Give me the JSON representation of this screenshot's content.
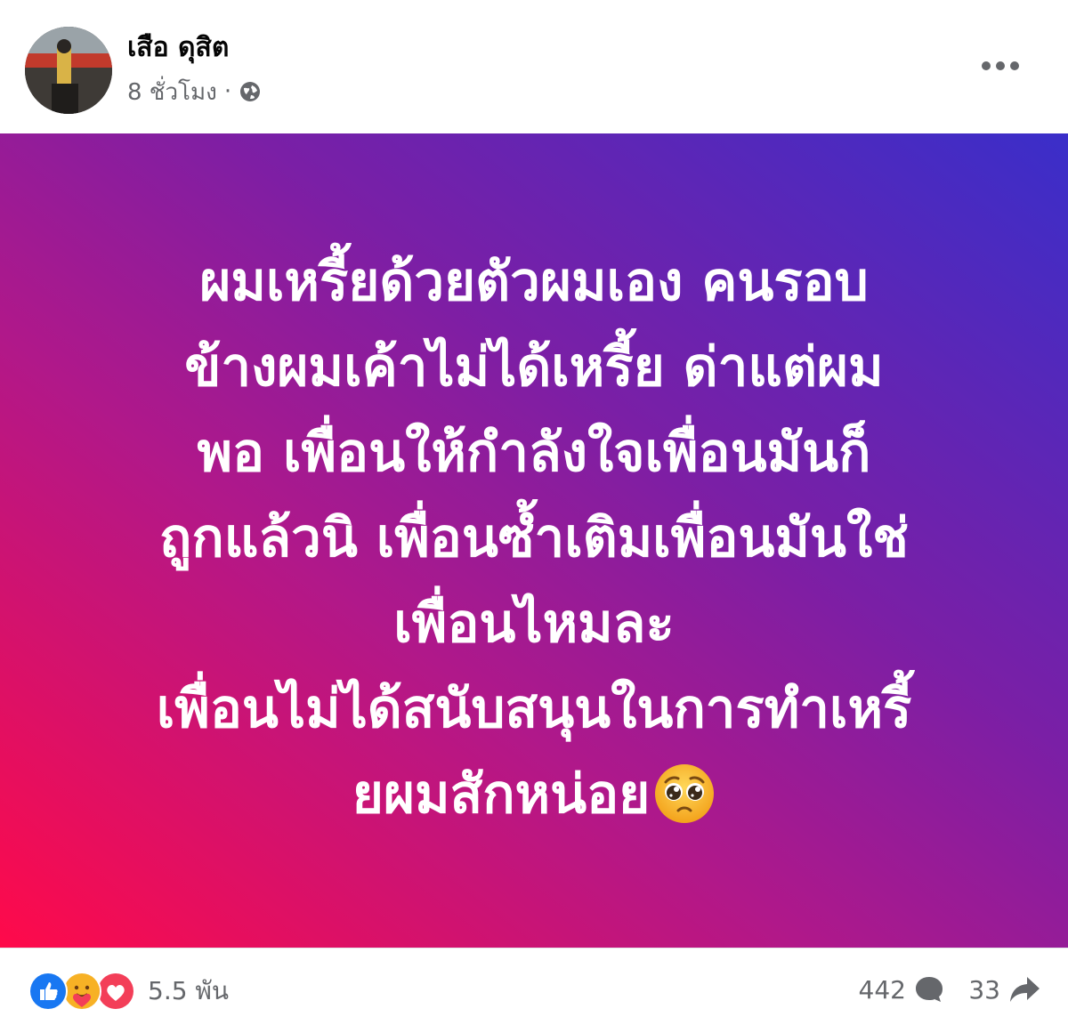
{
  "header": {
    "author_name": "เสือ ดุสิต",
    "time_ago": "8 ชั่วโมง",
    "separator": "·",
    "privacy_icon": "globe-icon",
    "more_icon": "more-options-icon"
  },
  "post": {
    "background_colors": [
      "#ff0a4a",
      "#b0188a",
      "#7a1fa6",
      "#3a2ec9"
    ],
    "text_color": "#ffffff",
    "lines": [
      "ผมเหรี้ยด้วยตัวผมเอง คนรอบ",
      "ข้างผมเค้าไม่ได้เหรี้ย ด่าแต่ผม",
      "พอ เพื่อนให้กำลังใจเพื่อนมันก็",
      "ถูกแล้วนิ เพื่อนซ้ำเติมเพื่อนมันใช่",
      "เพื่อนไหมละ",
      "เพื่อนไม่ได้สนับสนุนในการทำเหรี้",
      "ยผมสักหน่อย"
    ],
    "trailing_emoji": "pleading-face-emoji"
  },
  "footer": {
    "reaction_icons": [
      "like-icon",
      "care-icon",
      "love-icon"
    ],
    "reaction_count": "5.5 พัน",
    "comment_count": "442",
    "share_count": "33"
  }
}
